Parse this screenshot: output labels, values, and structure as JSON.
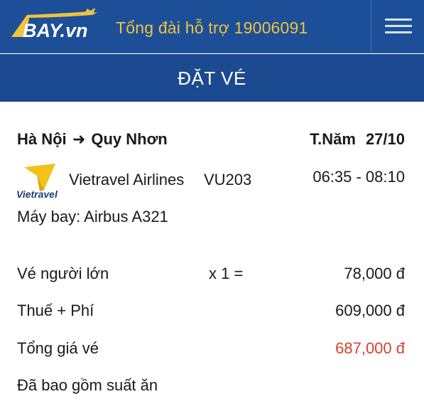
{
  "header": {
    "logo_text": "BAY.vn",
    "hotline": "Tổng đài hỗ trợ 19006091"
  },
  "page_title": "ĐẶT VÉ",
  "flight": {
    "origin": "Hà Nội",
    "destination": "Quy Nhơn",
    "weekday": "T.Năm",
    "date": "27/10",
    "airline": "Vietravel Airlines",
    "airline_logo_text": "Vietravel",
    "flight_number": "VU203",
    "time": "06:35 - 08:10",
    "aircraft": "Máy bay: Airbus A321"
  },
  "pricing": {
    "adult_label": "Vé người lớn",
    "adult_qty": "x 1 =",
    "adult_price": "78,000 đ",
    "tax_label": "Thuế + Phí",
    "tax_price": "609,000 đ",
    "total_label": "Tổng giá vé",
    "total_price": "687,000 đ",
    "meal_note": "Đã bao gồm suất ăn"
  },
  "colors": {
    "header_bg": "#1d4f98",
    "title_bg": "#1c4a90",
    "hotline": "#f0c33c",
    "total_price": "#d9412e"
  }
}
